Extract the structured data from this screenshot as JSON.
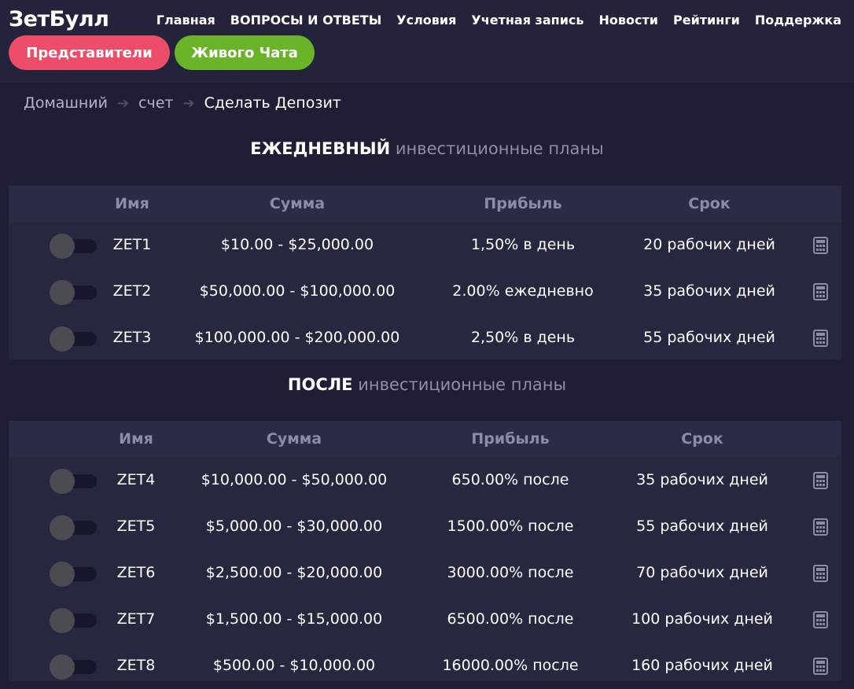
{
  "header": {
    "logo": "ЗетБулл",
    "nav": [
      "Главная",
      "ВОПРОСЫ И ОТВЕТЫ",
      "Условия",
      "Учетная запись",
      "Новости",
      "Рейтинги",
      "Поддержка"
    ],
    "representatives_button": "Представители",
    "live_chat_button": "Живого Чата"
  },
  "breadcrumb": [
    "Домашний",
    "счет",
    "Сделать Депозит"
  ],
  "daily_section": {
    "title_strong": "ЕЖЕДНЕВНЫЙ",
    "title_muted": "инвестиционные планы",
    "columns": [
      "Имя",
      "Сумма",
      "Прибыль",
      "Срок"
    ],
    "rows": [
      {
        "name": "ZET1",
        "amount": "$10.00 - $25,000.00",
        "profit": "1,50% в день",
        "term": "20 рабочих дней"
      },
      {
        "name": "ZET2",
        "amount": "$50,000.00 - $100,000.00",
        "profit": "2.00% ежедневно",
        "term": "35 рабочих дней"
      },
      {
        "name": "ZET3",
        "amount": "$100,000.00 - $200,000.00",
        "profit": "2,50% в день",
        "term": "55 рабочих дней"
      }
    ]
  },
  "after_section": {
    "title_strong": "ПОСЛЕ",
    "title_muted": "инвестиционные планы",
    "columns": [
      "Имя",
      "Сумма",
      "Прибыль",
      "Срок"
    ],
    "rows": [
      {
        "name": "ZET4",
        "amount": "$10,000.00 - $50,000.00",
        "profit": "650.00% после",
        "term": "35 рабочих дней"
      },
      {
        "name": "ZET5",
        "amount": "$5,000.00 - $30,000.00",
        "profit": "1500.00% после",
        "term": "55 рабочих дней"
      },
      {
        "name": "ZET6",
        "amount": "$2,500.00 - $20,000.00",
        "profit": "3000.00% после",
        "term": "70 рабочих дней"
      },
      {
        "name": "ZET7",
        "amount": "$1,500.00 - $15,000.00",
        "profit": "6500.00% после",
        "term": "100 рабочих дней"
      },
      {
        "name": "ZET8",
        "amount": "$500.00 - $10,000.00",
        "profit": "16000.00% после",
        "term": "160 рабочих дней"
      }
    ]
  },
  "colors": {
    "background": "#1e1f34",
    "panel": "#26283f",
    "representatives": "#ee4d69",
    "live_chat": "#6ab42a",
    "header_text_muted": "#8b8ca6"
  },
  "icons": [
    "arrow-right-icon",
    "calculator-icon"
  ]
}
